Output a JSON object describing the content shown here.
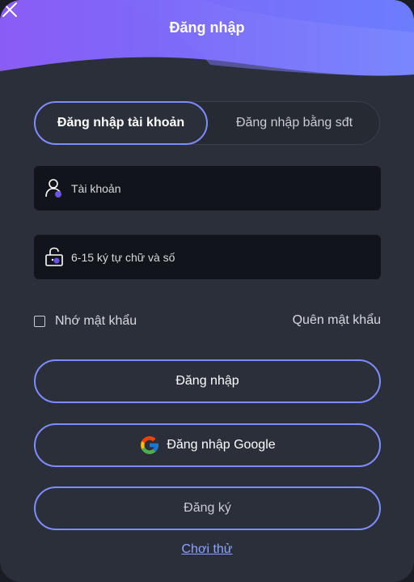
{
  "header": {
    "title": "Đăng nhập",
    "colors": {
      "gradient_start": "#8a63f5",
      "gradient_end": "#6f7dfb"
    }
  },
  "tabs": [
    {
      "label": "Đăng nhập tài khoản",
      "active": true
    },
    {
      "label": "Đăng nhập bằng sđt",
      "active": false
    }
  ],
  "fields": {
    "account": {
      "placeholder": "Tài khoản",
      "icon": "user-icon"
    },
    "password": {
      "placeholder": "6-15 ký tự chữ và số",
      "icon": "lock-icon"
    }
  },
  "options": {
    "remember_label": "Nhớ mật khẩu",
    "remember_checked": false,
    "forgot_label": "Quên mật khẩu"
  },
  "buttons": {
    "login": "Đăng nhập",
    "google_login": "Đăng nhập Google",
    "register": "Đăng ký"
  },
  "trial_link": "Chơi thử",
  "accent_color": "#7e8cff"
}
